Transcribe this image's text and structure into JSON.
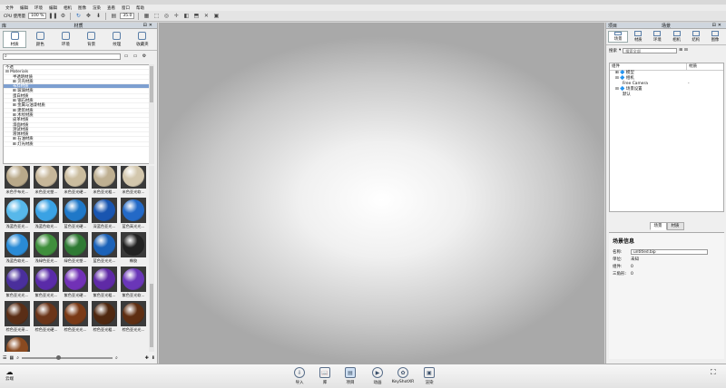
{
  "menu": [
    "文件",
    "编辑",
    "环境",
    "编辑",
    "相机",
    "图像",
    "渲染",
    "查看",
    "窗口",
    "帮助"
  ],
  "toolbar": {
    "perf_label": "CPU 使用量",
    "perf_value": "100 %",
    "zoom_value": "35.0"
  },
  "library": {
    "title": "材质",
    "corner": "库",
    "tabs": [
      "材质",
      "颜色",
      "环境",
      "背景",
      "纹理",
      "收藏夹"
    ],
    "search_placeholder": "",
    "tree": [
      {
        "label": "  不透",
        "indent": 0,
        "selected": false
      },
      {
        "label": "⊟ Materials",
        "indent": 0,
        "selected": false
      },
      {
        "label": "半透明材质",
        "indent": 2,
        "selected": false
      },
      {
        "label": "⊞ 贝壳材质",
        "indent": 2,
        "selected": false
      },
      {
        "label": "布料材质",
        "indent": 2,
        "selected": true
      },
      {
        "label": "⊞ 玻璃材质",
        "indent": 2,
        "selected": false
      },
      {
        "label": "蛋白材质",
        "indent": 2,
        "selected": false
      },
      {
        "label": "⊞ 钢石材质",
        "indent": 2,
        "selected": false
      },
      {
        "label": "⊞ 金属与油漆材质",
        "indent": 2,
        "selected": false
      },
      {
        "label": "⊞ 建筑材质",
        "indent": 2,
        "selected": false
      },
      {
        "label": "⊞ 木纹材质",
        "indent": 2,
        "selected": false
      },
      {
        "label": "皮革材质",
        "indent": 2,
        "selected": false
      },
      {
        "label": "漆面材质",
        "indent": 2,
        "selected": false
      },
      {
        "label": "测试材质",
        "indent": 2,
        "selected": false
      },
      {
        "label": "液体材质",
        "indent": 2,
        "selected": false
      },
      {
        "label": "⊞ 石油材质",
        "indent": 2,
        "selected": false
      },
      {
        "label": "⊞ 灯光材质",
        "indent": 2,
        "selected": false
      }
    ],
    "materials": [
      {
        "label": "米色手布光...",
        "color": "#b9a98a"
      },
      {
        "label": "米色亚光塑...",
        "color": "#c7b79a"
      },
      {
        "label": "米色亚光硬...",
        "color": "#cbbd9f"
      },
      {
        "label": "米色亚光粗...",
        "color": "#bfb092"
      },
      {
        "label": "米色亚光软...",
        "color": "#d3c7ad"
      },
      {
        "label": "浅蓝色亚光...",
        "color": "#57b8ea"
      },
      {
        "label": "浅蓝色软光...",
        "color": "#3aa2e4"
      },
      {
        "label": "蓝色亚光硬...",
        "color": "#1f78c8"
      },
      {
        "label": "深蓝色亚光...",
        "color": "#1955b0"
      },
      {
        "label": "蓝色高光光...",
        "color": "#2369c7"
      },
      {
        "label": "浅蓝色软光...",
        "color": "#2a8bd6"
      },
      {
        "label": "浅绿色亚光...",
        "color": "#3f8f3c"
      },
      {
        "label": "绿色亚光塑...",
        "color": "#2f7a34"
      },
      {
        "label": "蓝色亚光光...",
        "color": "#1b62b8"
      },
      {
        "label": "橡胶",
        "color": "#222222"
      },
      {
        "label": "紫色亚光光...",
        "color": "#4a2f9c"
      },
      {
        "label": "紫色亚光光...",
        "color": "#5a2ba8"
      },
      {
        "label": "紫色亚光硬...",
        "color": "#7131b6"
      },
      {
        "label": "紫色亚光粗...",
        "color": "#5f2aa6"
      },
      {
        "label": "紫色亚光软...",
        "color": "#6a36b8"
      },
      {
        "label": "棕色亚光采...",
        "color": "#5a2e16"
      },
      {
        "label": "棕色亚光硬...",
        "color": "#6b3519"
      },
      {
        "label": "棕色亚光光...",
        "color": "#7a3a16"
      },
      {
        "label": "棕色亚光粗...",
        "color": "#4f2810"
      },
      {
        "label": "棕色亚光光...",
        "color": "#5e2e12"
      },
      {
        "label": "棕色柔软橙...",
        "color": "#8a4a20"
      }
    ]
  },
  "scene": {
    "title": "场景",
    "corner": "项目",
    "tabs": [
      "场景",
      "材质",
      "环境",
      "相机",
      "结构",
      "图像"
    ],
    "filter_label": "搜索",
    "filter_placeholder": "搜索全部",
    "col_name": "组件",
    "col_material": "材质",
    "tree": [
      {
        "label": "⊞ 🔷 模型",
        "value": "",
        "indent": 1
      },
      {
        "label": "⊟ 🔷 相机",
        "value": "",
        "indent": 1
      },
      {
        "label": "Free Camera",
        "value": "-",
        "indent": 3
      },
      {
        "label": "⊟ 🔷 场景设置",
        "value": "",
        "indent": 1
      },
      {
        "label": "默认",
        "value": "",
        "indent": 3
      }
    ],
    "subtabs": [
      "场景",
      "材质"
    ],
    "info_title": "场景信息",
    "info": [
      {
        "key": "名称:",
        "value": "untitled.bip",
        "input": true
      },
      {
        "key": "单位:",
        "value": "未知",
        "input": false
      },
      {
        "key": "组件:",
        "value": "0",
        "input": false
      },
      {
        "key": "三角形:",
        "value": "0",
        "input": false
      }
    ]
  },
  "bottom": {
    "left_label": "云端",
    "right_label": "",
    "buttons": [
      {
        "label": "导入",
        "active": false
      },
      {
        "label": "库",
        "active": false
      },
      {
        "label": "项目",
        "active": true
      },
      {
        "label": "动画",
        "active": false
      },
      {
        "label": "KeyShotXR",
        "active": false
      },
      {
        "label": "渲染",
        "active": false
      }
    ]
  }
}
